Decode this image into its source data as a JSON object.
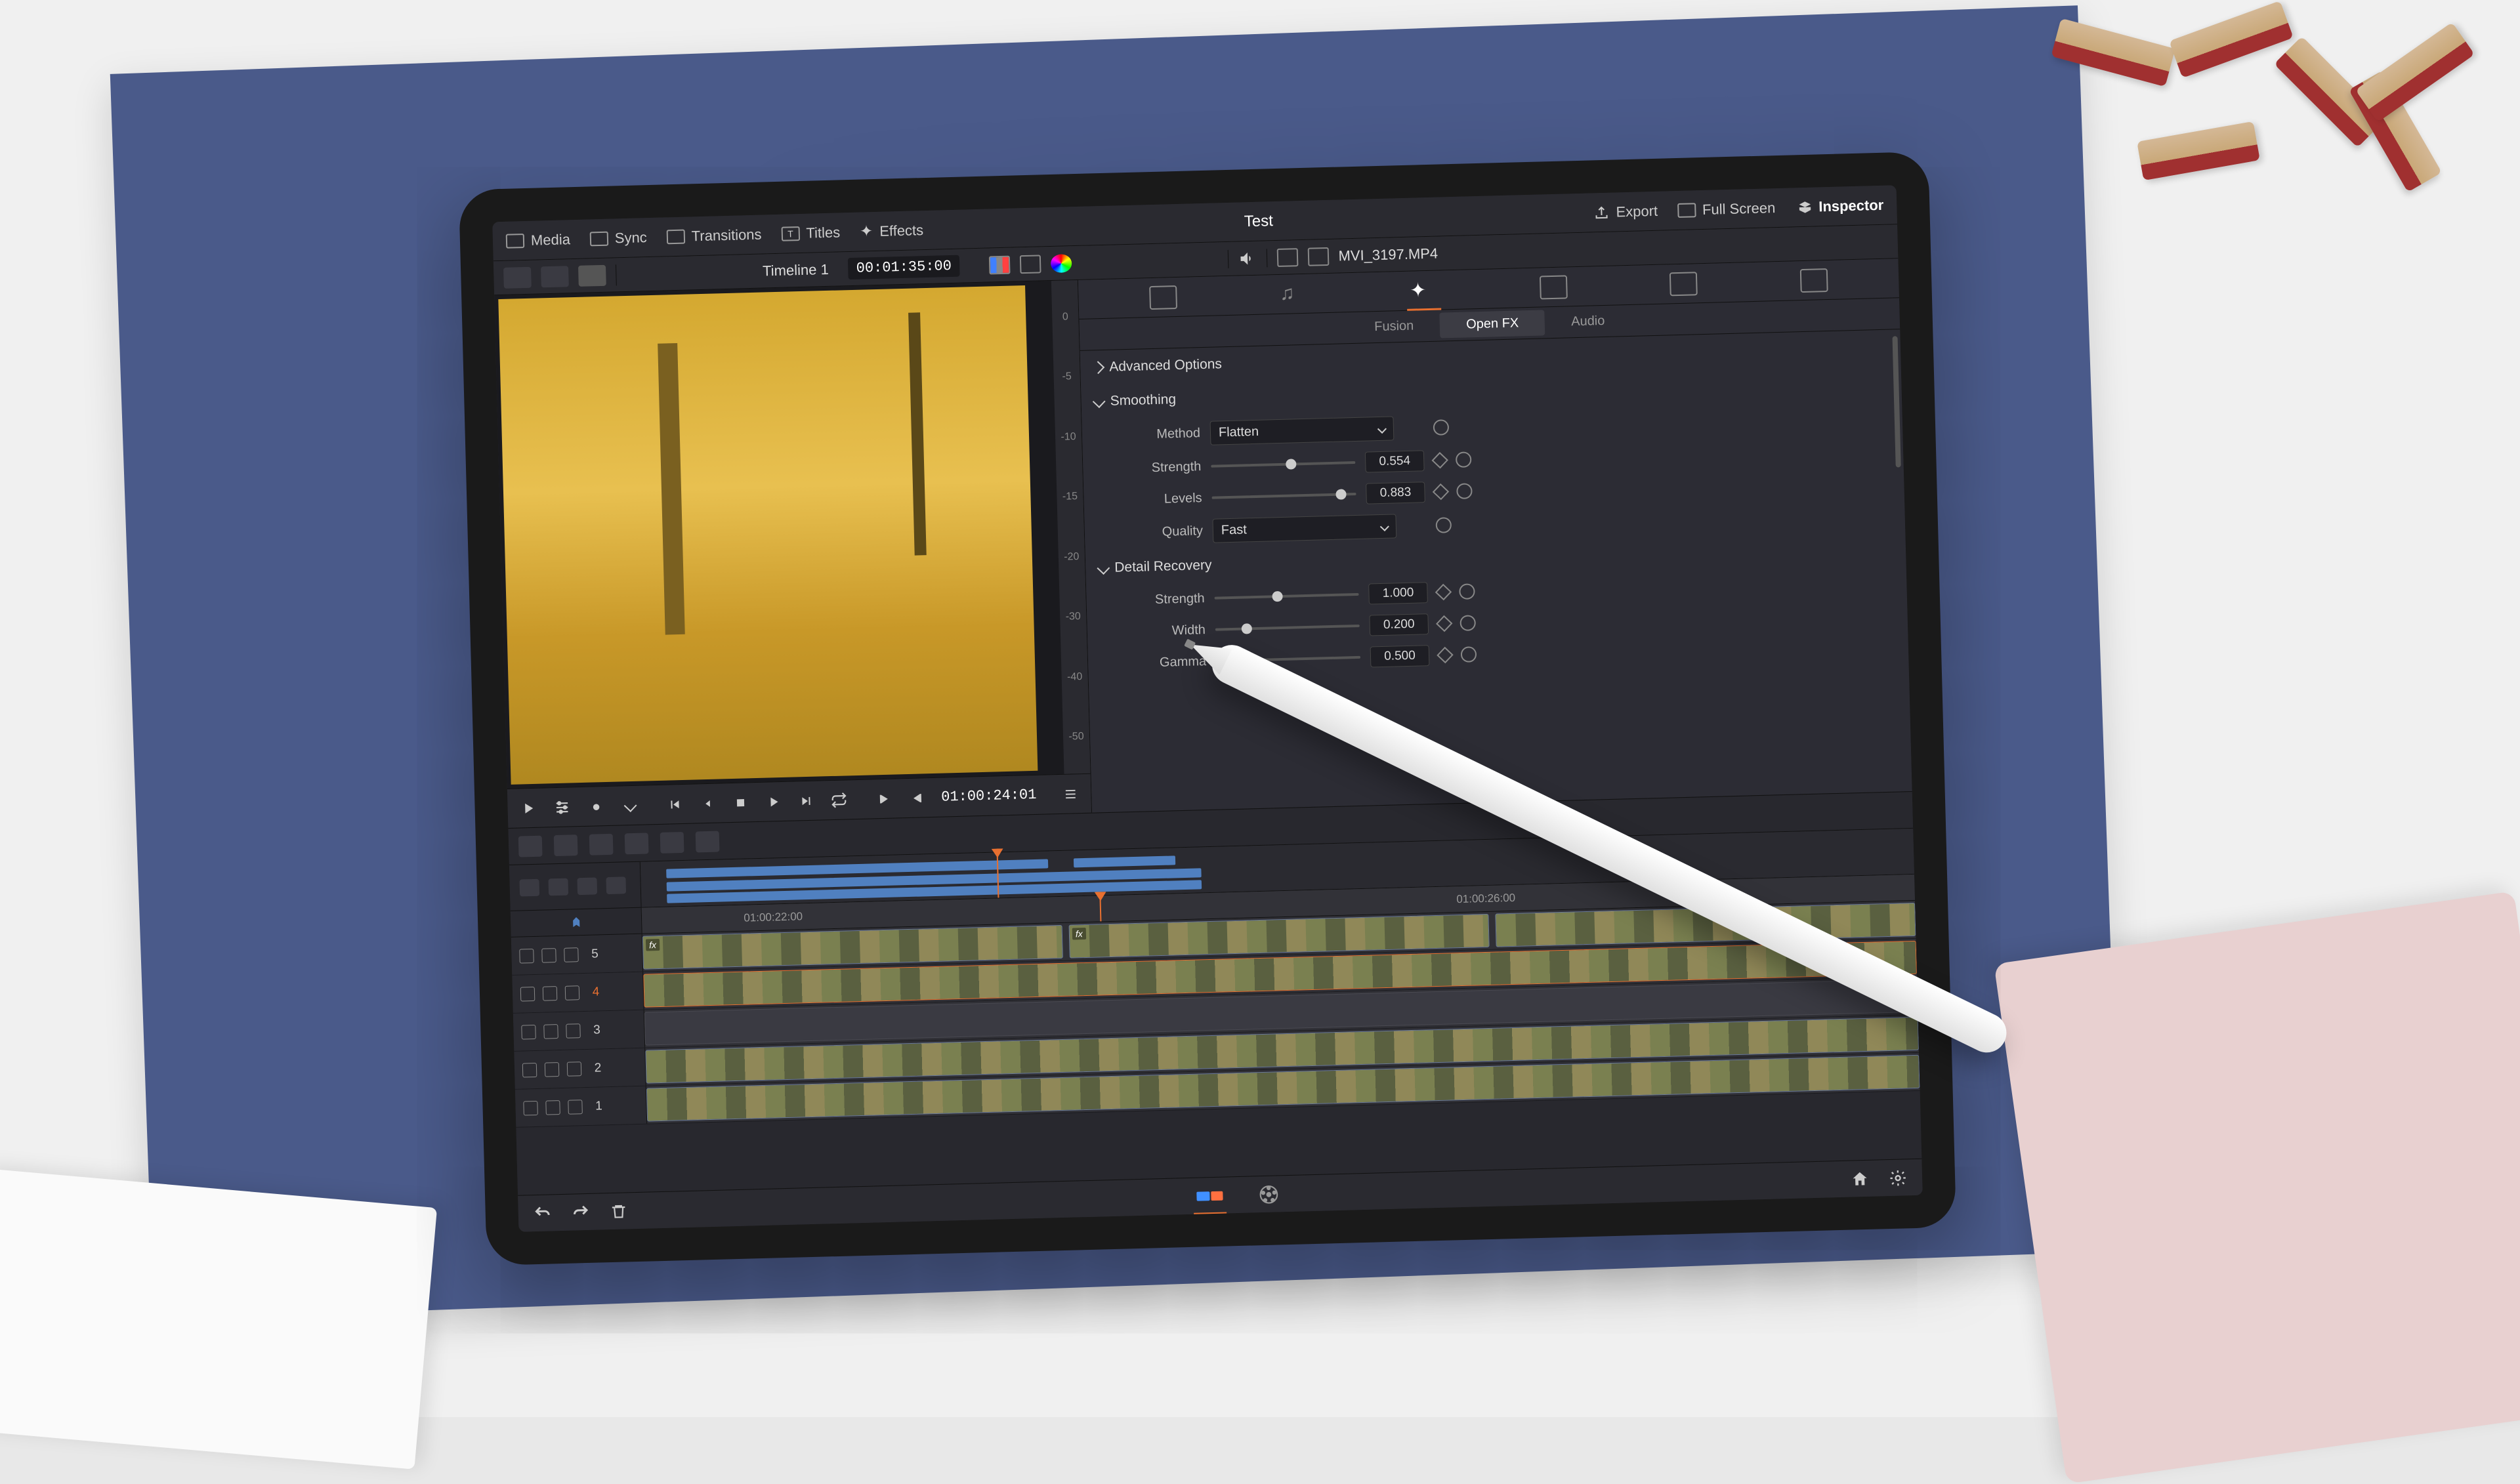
{
  "toolbar": {
    "media": "Media",
    "sync": "Sync",
    "transitions": "Transitions",
    "titles": "Titles",
    "effects": "Effects",
    "project_title": "Test",
    "export": "Export",
    "full_screen": "Full Screen",
    "inspector": "Inspector"
  },
  "secondbar": {
    "timeline_label": "Timeline 1",
    "timecode": "00:01:35:00",
    "clip_filename": "MVI_3197.MP4"
  },
  "viewer": {
    "volume_marks": [
      "0",
      "-5",
      "-10",
      "-15",
      "-20",
      "-30",
      "-40",
      "-50"
    ]
  },
  "transport": {
    "timecode": "01:00:24:01"
  },
  "inspector": {
    "subtabs": {
      "fusion": "Fusion",
      "openfx": "Open FX",
      "audio": "Audio"
    },
    "sections": {
      "advanced": "Advanced Options",
      "smoothing": "Smoothing",
      "detail": "Detail Recovery"
    },
    "params": {
      "method_label": "Method",
      "method_value": "Flatten",
      "strength_label": "Strength",
      "strength_value": "0.554",
      "levels_label": "Levels",
      "levels_value": "0.883",
      "quality_label": "Quality",
      "quality_value": "Fast",
      "dr_strength_label": "Strength",
      "dr_strength_value": "1.000",
      "width_label": "Width",
      "width_value": "0.200",
      "gamma_label": "Gamma",
      "gamma_value": "0.500"
    }
  },
  "timeline": {
    "ruler": {
      "t1": "01:00:22:00",
      "t2": "01:00:26:00"
    },
    "tracks": [
      {
        "num": "5",
        "active": false
      },
      {
        "num": "4",
        "active": true
      },
      {
        "num": "3",
        "active": false
      },
      {
        "num": "2",
        "active": false
      },
      {
        "num": "1",
        "active": false
      }
    ],
    "fx_badge": "fx"
  }
}
